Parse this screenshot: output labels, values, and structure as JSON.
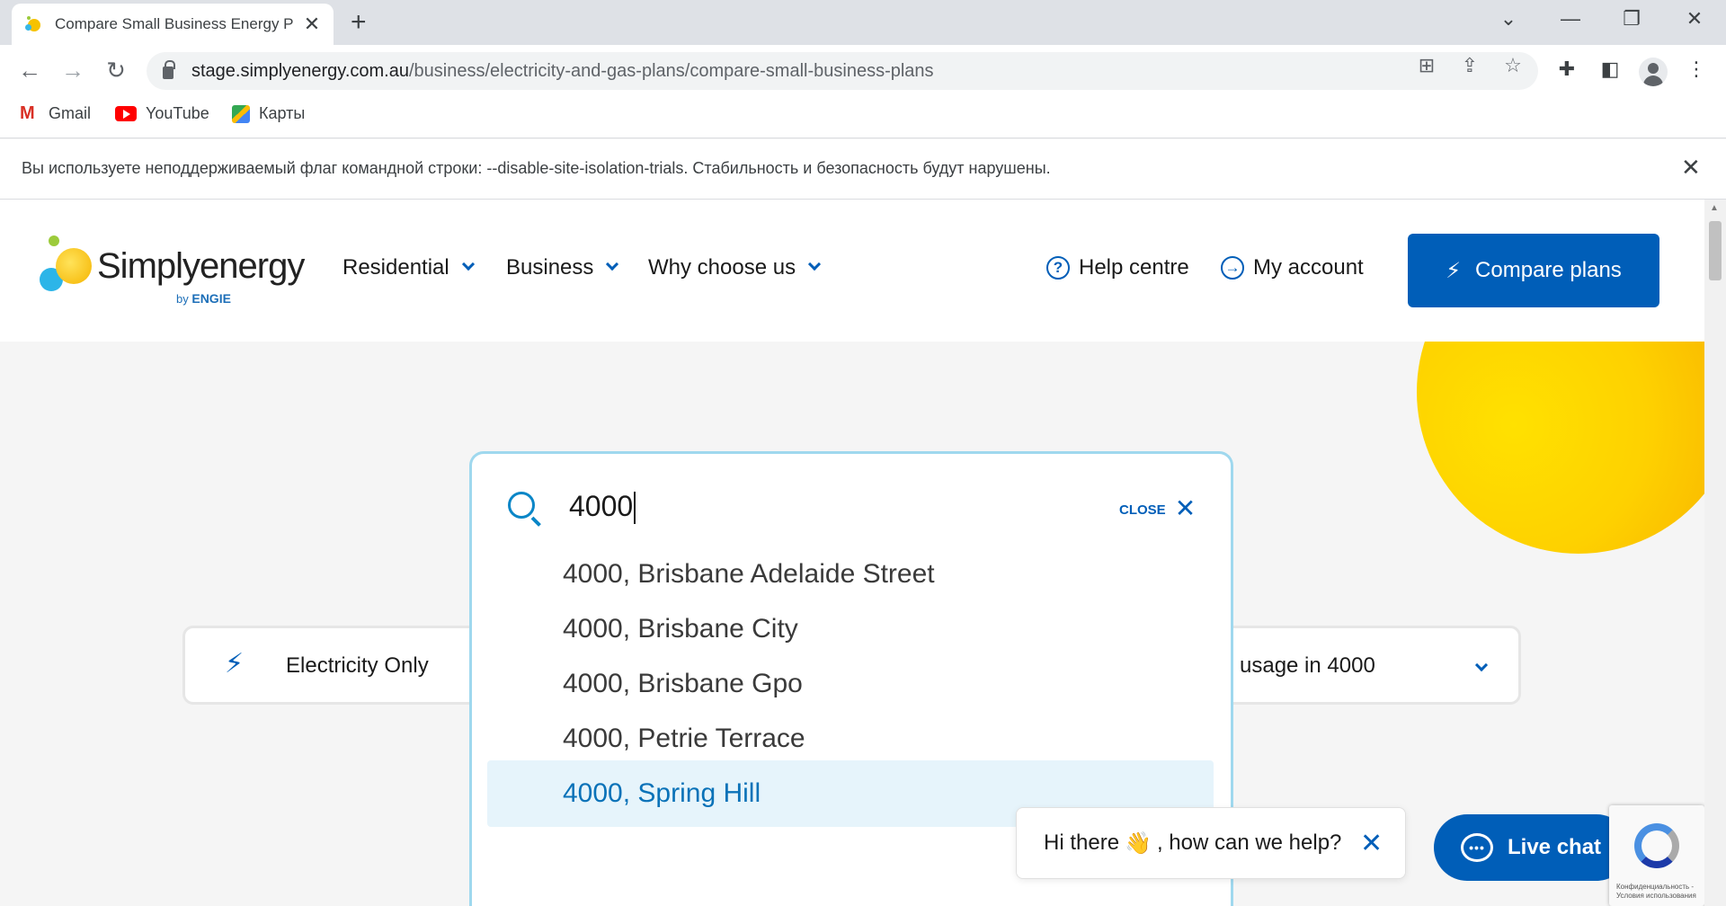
{
  "browser": {
    "tab_title": "Compare Small Business Energy P",
    "url_host": "stage.simplyenergy.com.au",
    "url_path": "/business/electricity-and-gas-plans/compare-small-business-plans",
    "bookmarks": [
      "Gmail",
      "YouTube",
      "Карты"
    ],
    "infobar_message": "Вы используете неподдерживаемый флаг командной строки: --disable-site-isolation-trials. Стабильность и безопасность будут нарушены."
  },
  "site": {
    "logo_word": "Simplyenergy",
    "logo_by": "by",
    "logo_brand": "ENGIE",
    "nav": [
      "Residential",
      "Business",
      "Why choose us"
    ],
    "help_centre": "Help centre",
    "my_account": "My account",
    "compare_plans": "Compare plans",
    "colors": {
      "brand_blue": "#005eb8",
      "sun_yellow": "#fed100",
      "search_border": "#9fd8ee",
      "highlight": "#e6f4fb"
    }
  },
  "search": {
    "query": "4000",
    "close_label": "CLOSE",
    "suggestions": [
      "4000, Brisbane Adelaide Street",
      "4000, Brisbane City",
      "4000, Brisbane Gpo",
      "4000, Petrie Terrace",
      "4000, Spring Hill"
    ],
    "highlighted_index": 4
  },
  "selectors": {
    "fuel": "Electricity Only",
    "usage": "usage in 4000"
  },
  "chat": {
    "greeting_prefix": "Hi there",
    "greeting_emoji": "👋",
    "greeting_suffix": ", how can we help?",
    "live_chat": "Live chat"
  },
  "recaptcha_text": "Конфиденциальность - Условия использования"
}
